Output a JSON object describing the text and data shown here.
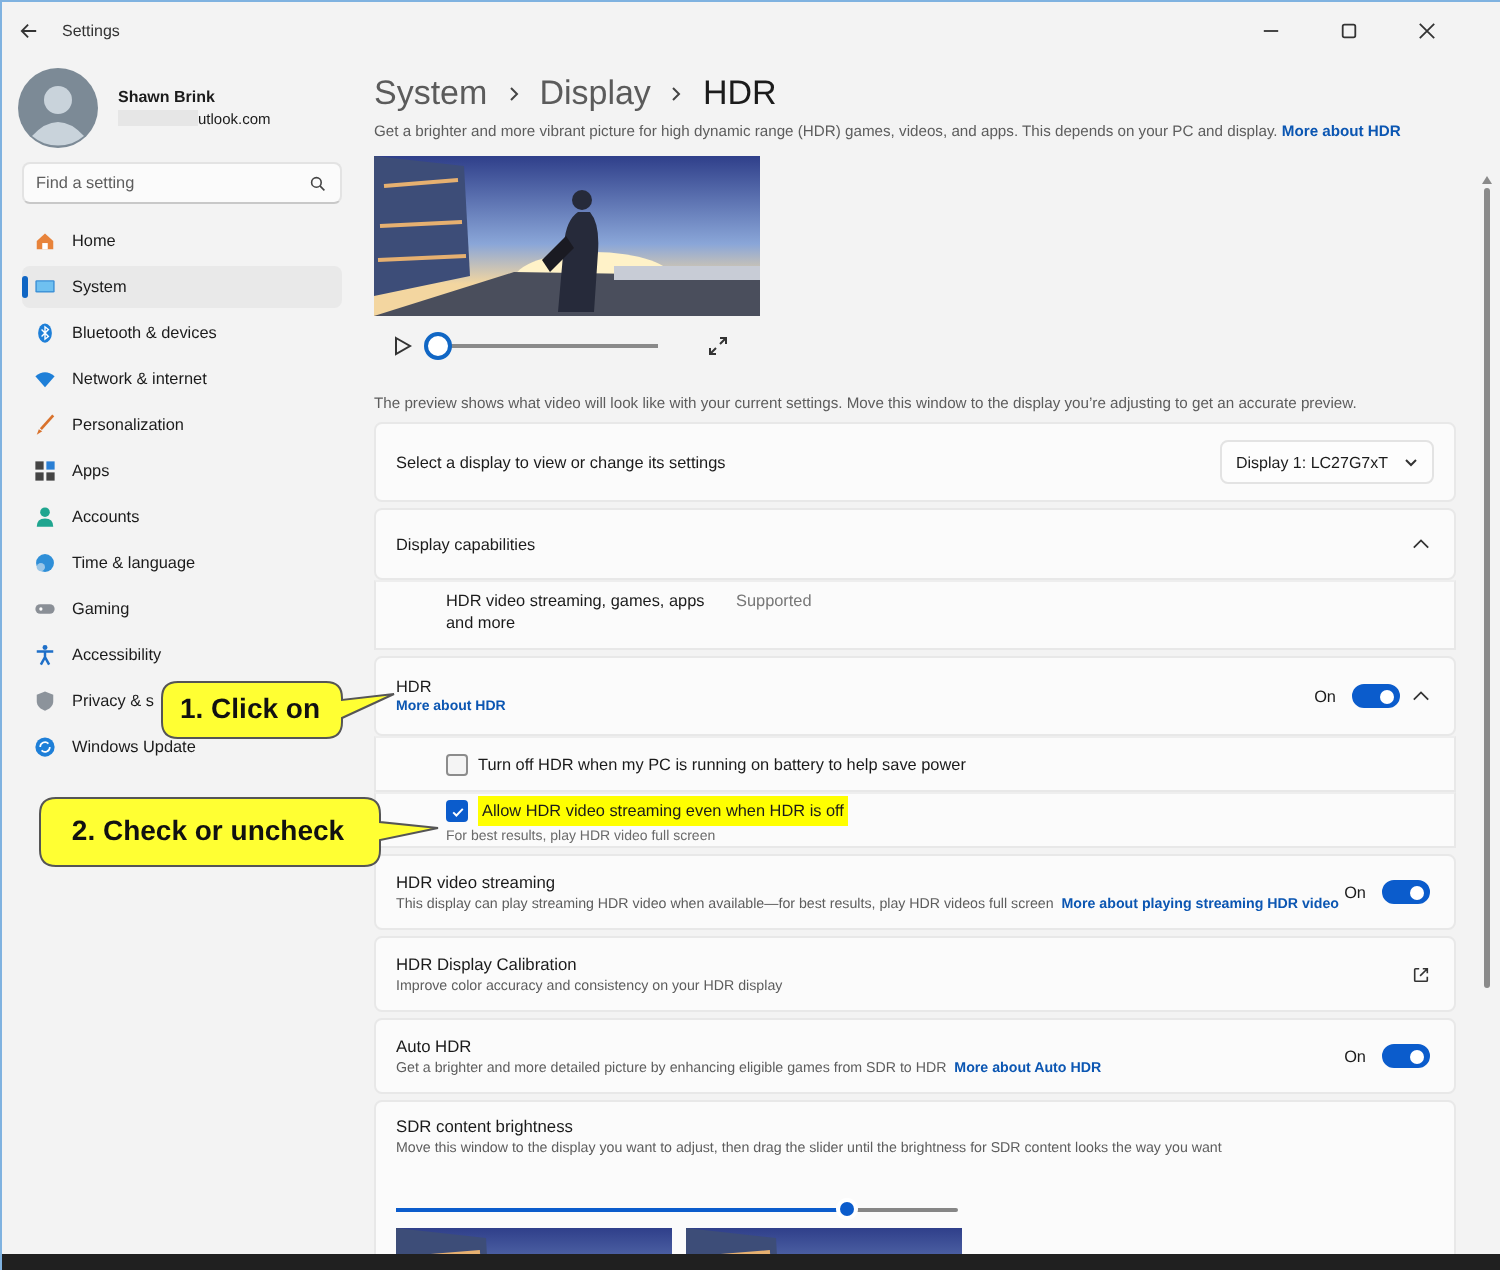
{
  "window": {
    "title": "Settings"
  },
  "user": {
    "name": "Shawn Brink",
    "email": "utlook.com"
  },
  "search": {
    "placeholder": "Find a setting"
  },
  "nav": [
    {
      "label": "Home",
      "selected": false
    },
    {
      "label": "System",
      "selected": true
    },
    {
      "label": "Bluetooth & devices",
      "selected": false
    },
    {
      "label": "Network & internet",
      "selected": false
    },
    {
      "label": "Personalization",
      "selected": false
    },
    {
      "label": "Apps",
      "selected": false
    },
    {
      "label": "Accounts",
      "selected": false
    },
    {
      "label": "Time & language",
      "selected": false
    },
    {
      "label": "Gaming",
      "selected": false
    },
    {
      "label": "Accessibility",
      "selected": false
    },
    {
      "label": "Privacy & s",
      "selected": false
    },
    {
      "label": "Windows Update",
      "selected": false
    }
  ],
  "breadcrumb": [
    "System",
    "Display",
    "HDR"
  ],
  "intro": {
    "text": "Get a brighter and more vibrant picture for high dynamic range (HDR) games, videos, and apps. This depends on your PC and display.",
    "link": "More about HDR"
  },
  "preview": {
    "level": 0
  },
  "preview_note": "The preview shows what video will look like with your current settings. Move this window to the display you’re adjusting to get an accurate preview.",
  "display_select": {
    "label": "Select a display to view or change its settings",
    "value": "Display 1: LC27G7xT"
  },
  "capabilities": {
    "title": "Display capabilities",
    "expanded": true,
    "rows": [
      {
        "name": "HDR video streaming, games, apps and more",
        "value": "Supported"
      }
    ]
  },
  "hdr": {
    "title": "HDR",
    "link": "More about HDR",
    "state": "On",
    "on": true,
    "expanded": true,
    "options": [
      {
        "label": "Turn off HDR when my PC is running on battery to help save power",
        "checked": false,
        "highlighted": false
      },
      {
        "label": "Allow HDR video streaming even when HDR is off",
        "checked": true,
        "highlighted": true,
        "hint": "For best results, play HDR video full screen"
      }
    ]
  },
  "settings": [
    {
      "kind": "toggle",
      "title": "HDR video streaming",
      "description": "This display can play streaming HDR video when available—for best results, play HDR videos full screen",
      "link": "More about playing streaming HDR video",
      "state": "On",
      "on": true
    },
    {
      "kind": "external",
      "title": "HDR Display Calibration",
      "description": "Improve color accuracy and consistency on your HDR display"
    },
    {
      "kind": "toggle",
      "title": "Auto HDR",
      "description": "Get a brighter and more detailed picture by enhancing eligible games from SDR to HDR",
      "link": "More about Auto HDR",
      "state": "On",
      "on": true
    },
    {
      "kind": "slider",
      "title": "SDR content brightness",
      "description": "Move this window to the display you want to adjust, then drag the slider until the brightness for SDR content looks the way you want",
      "level": 0.8
    }
  ],
  "callouts": [
    {
      "text": "1. Click on"
    },
    {
      "text": "2. Check or uncheck"
    }
  ]
}
